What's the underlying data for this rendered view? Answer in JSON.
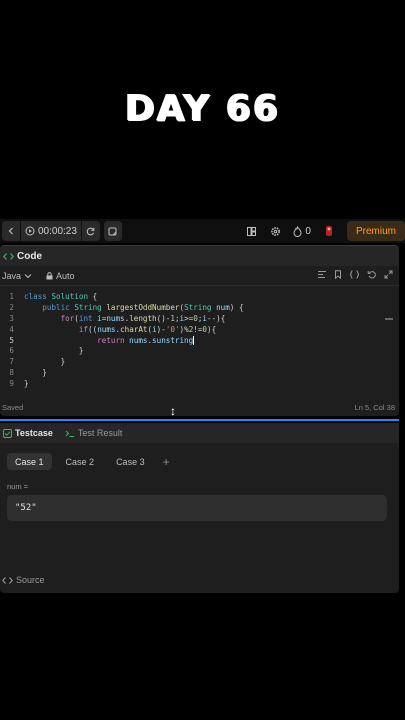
{
  "overlay": {
    "title": "DAY 66"
  },
  "toolbar": {
    "timer": "00:00:23",
    "streak_count": "0",
    "premium_label": "Premium",
    "icons": [
      "chevron-left-icon",
      "play-circle-icon",
      "refresh-icon",
      "note-icon",
      "layout-icon",
      "gear-icon",
      "fire-icon",
      "avatar-icon"
    ]
  },
  "code_panel": {
    "title": "Code",
    "language": "Java",
    "mode": "Auto",
    "lines": [
      "class Solution {",
      "    public String largestOddNumber(String num) {",
      "        for(int i=nums.length()-1;i>=0;i--){",
      "            if((nums.charAt(i)-'0')%2!=0){",
      "                return nums.sunstring",
      "            }",
      "        }",
      "    }",
      "}"
    ],
    "active_line": 5,
    "status_left": "Saved",
    "status_right": "Ln 5, Col 38"
  },
  "test_panel": {
    "tabs": [
      {
        "label": "Testcase",
        "active": true
      },
      {
        "label": "Test Result",
        "active": false
      }
    ],
    "cases": [
      {
        "label": "Case 1",
        "active": true
      },
      {
        "label": "Case 2",
        "active": false
      },
      {
        "label": "Case 3",
        "active": false
      }
    ],
    "add_label": "+",
    "variable_name": "num =",
    "variable_value": "\"52\"",
    "source_label": "Source"
  },
  "colors": {
    "accent": "#ffa116",
    "divider": "#1a8cff",
    "panel": "#1e1e1e"
  }
}
